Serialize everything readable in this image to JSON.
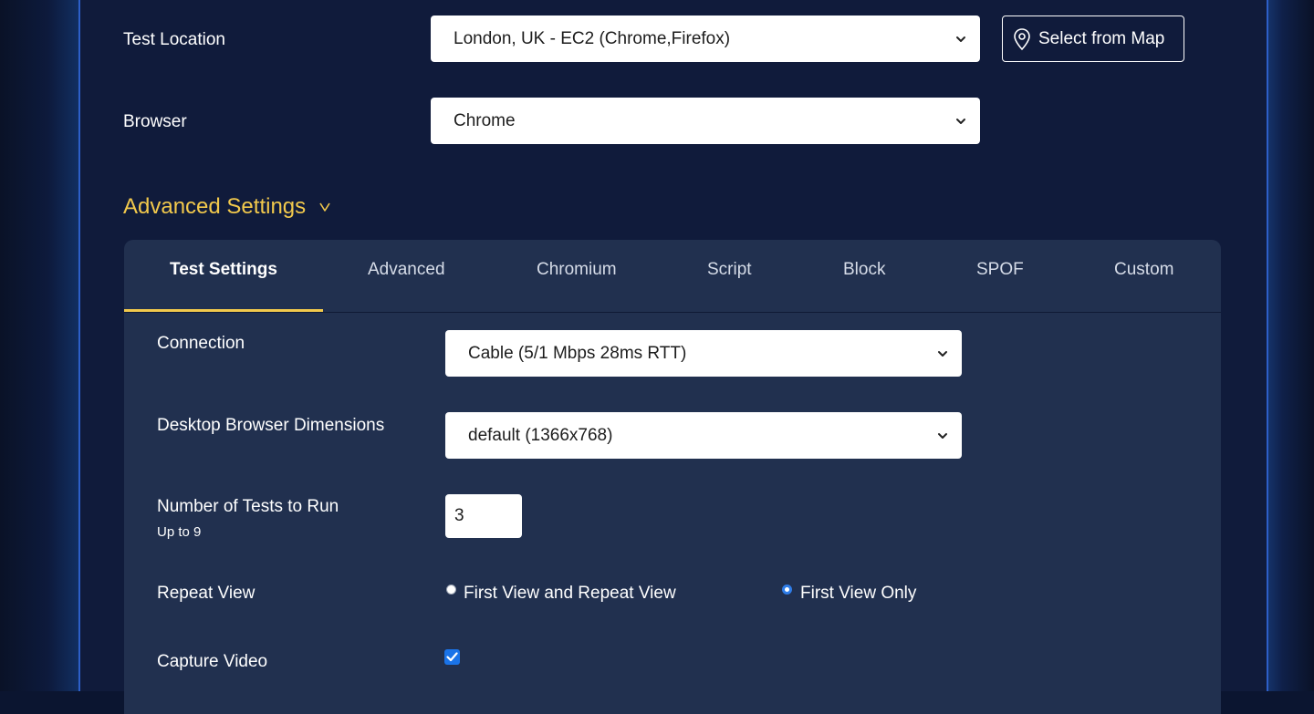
{
  "colors": {
    "accent": "#f2c94c",
    "frame_border": "#2d5fc8",
    "panel_bg": "#21304f",
    "page_bg": "#101b3b",
    "control_blue": "#1a73e8"
  },
  "location": {
    "label": "Test Location",
    "selected": "London, UK - EC2 (Chrome,Firefox)",
    "map_button_label": "Select from Map",
    "map_button_icon": "map-pin-icon"
  },
  "browser": {
    "label": "Browser",
    "selected": "Chrome"
  },
  "advanced": {
    "title": "Advanced Settings",
    "toggle_glyph": "v"
  },
  "tabs": [
    {
      "label": "Test Settings",
      "active": true
    },
    {
      "label": "Advanced",
      "active": false
    },
    {
      "label": "Chromium",
      "active": false
    },
    {
      "label": "Script",
      "active": false
    },
    {
      "label": "Block",
      "active": false
    },
    {
      "label": "SPOF",
      "active": false
    },
    {
      "label": "Custom",
      "active": false
    }
  ],
  "settings": {
    "connection": {
      "label": "Connection",
      "selected": "Cable (5/1 Mbps 28ms RTT)"
    },
    "dimensions": {
      "label": "Desktop Browser Dimensions",
      "selected": "default (1366x768)"
    },
    "tests": {
      "label": "Number of Tests to Run",
      "hint": "Up to 9",
      "value": "3"
    },
    "repeat_view": {
      "label": "Repeat View",
      "options": [
        {
          "label": "First View and Repeat View",
          "selected": false
        },
        {
          "label": "First View Only",
          "selected": true
        }
      ]
    },
    "capture_video": {
      "label": "Capture Video",
      "checked": true
    }
  }
}
